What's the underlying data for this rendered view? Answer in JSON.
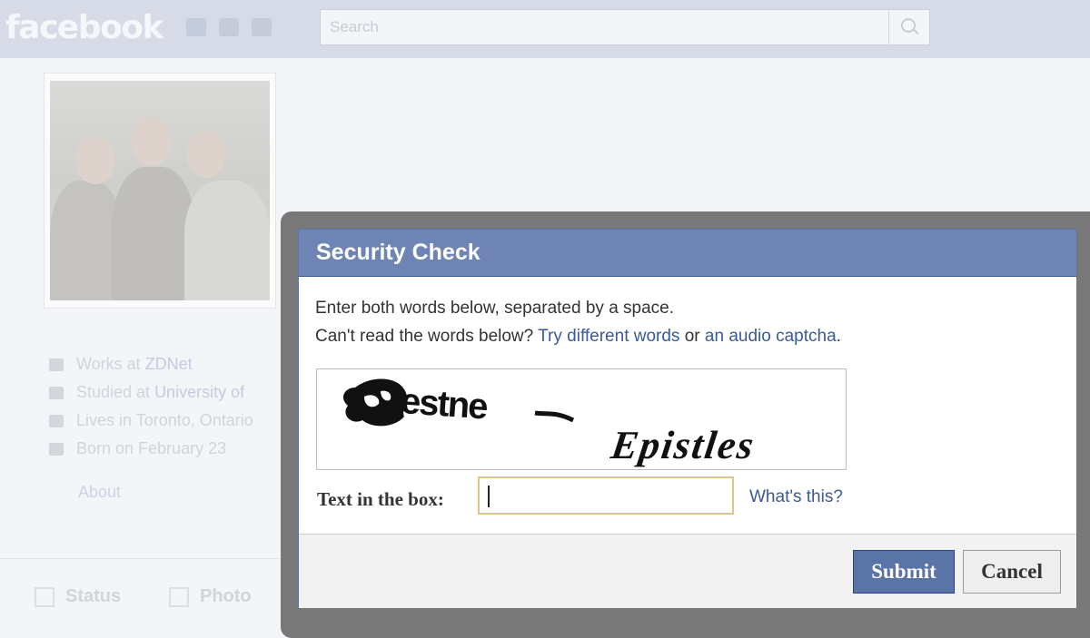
{
  "app": {
    "logo": "facebook",
    "search_placeholder": "Search"
  },
  "profile": {
    "info": [
      {
        "icon": "briefcase-icon",
        "text": "Works at ",
        "link": "ZDNet"
      },
      {
        "icon": "graduation-cap-icon",
        "text": "Studied at ",
        "link": "University of"
      },
      {
        "icon": "home-icon",
        "text": "Lives in Toronto, Ontario",
        "link": ""
      },
      {
        "icon": "calendar-icon",
        "text": "Born on February 23",
        "link": ""
      }
    ],
    "about_link": "About",
    "composer": {
      "status": "Status",
      "photo": "Photo"
    }
  },
  "dialog": {
    "title": "Security Check",
    "instruction": "Enter both words below, separated by a space.",
    "cant_read": "Can't read the words below?",
    "try_different": "Try different words",
    "or": "or",
    "audio_captcha": "an audio captcha",
    "period": ".",
    "captcha_words": [
      "estne",
      "Epistles"
    ],
    "text_label": "Text in the box:",
    "input_value": "",
    "whats_this": "What's this?",
    "submit": "Submit",
    "cancel": "Cancel"
  },
  "colors": {
    "header_blue": "#6d84b4",
    "link_blue": "#3b5998",
    "submit_blue": "#5b74a8",
    "input_border": "#dfc58d"
  }
}
